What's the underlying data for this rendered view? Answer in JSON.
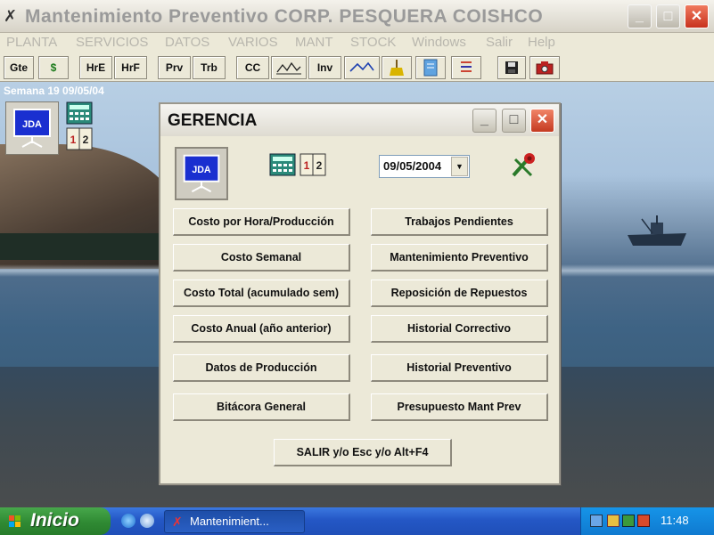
{
  "app": {
    "title": "Mantenimiento Preventivo  CORP. PESQUERA COISHCO",
    "min": "_",
    "max": "□",
    "close": "✕"
  },
  "menu": [
    "PLANTA",
    "SERVICIOS",
    "DATOS",
    "VARIOS",
    "MANT",
    "STOCK",
    "Windows",
    "Salir",
    "Help"
  ],
  "toolbar": {
    "gte": "Gte",
    "dollar": "$",
    "hre": "HrE",
    "hrf": "HrF",
    "prv": "Prv",
    "trb": "Trb",
    "cc": "CC",
    "inv": "Inv"
  },
  "desktop": {
    "week": "Semana 19   09/05/04",
    "jda": "JDA"
  },
  "dialog": {
    "title": "GERENCIA",
    "date": "09/05/2004",
    "jda": "JDA",
    "left_buttons": [
      "Costo por Hora/Producción",
      "Costo Semanal",
      "Costo Total (acumulado sem)",
      "Costo Anual (año anterior)",
      "Datos de Producción",
      "Bitácora General"
    ],
    "right_buttons": [
      "Trabajos Pendientes",
      "Mantenimiento Preventivo",
      "Reposición de Repuestos",
      "Historial Correctivo",
      "Historial Preventivo",
      "Presupuesto Mant Prev"
    ],
    "exit": "SALIR y/o Esc y/o Alt+F4"
  },
  "taskbar": {
    "start": "Inicio",
    "task": "Mantenimient...",
    "clock": "11:48"
  }
}
